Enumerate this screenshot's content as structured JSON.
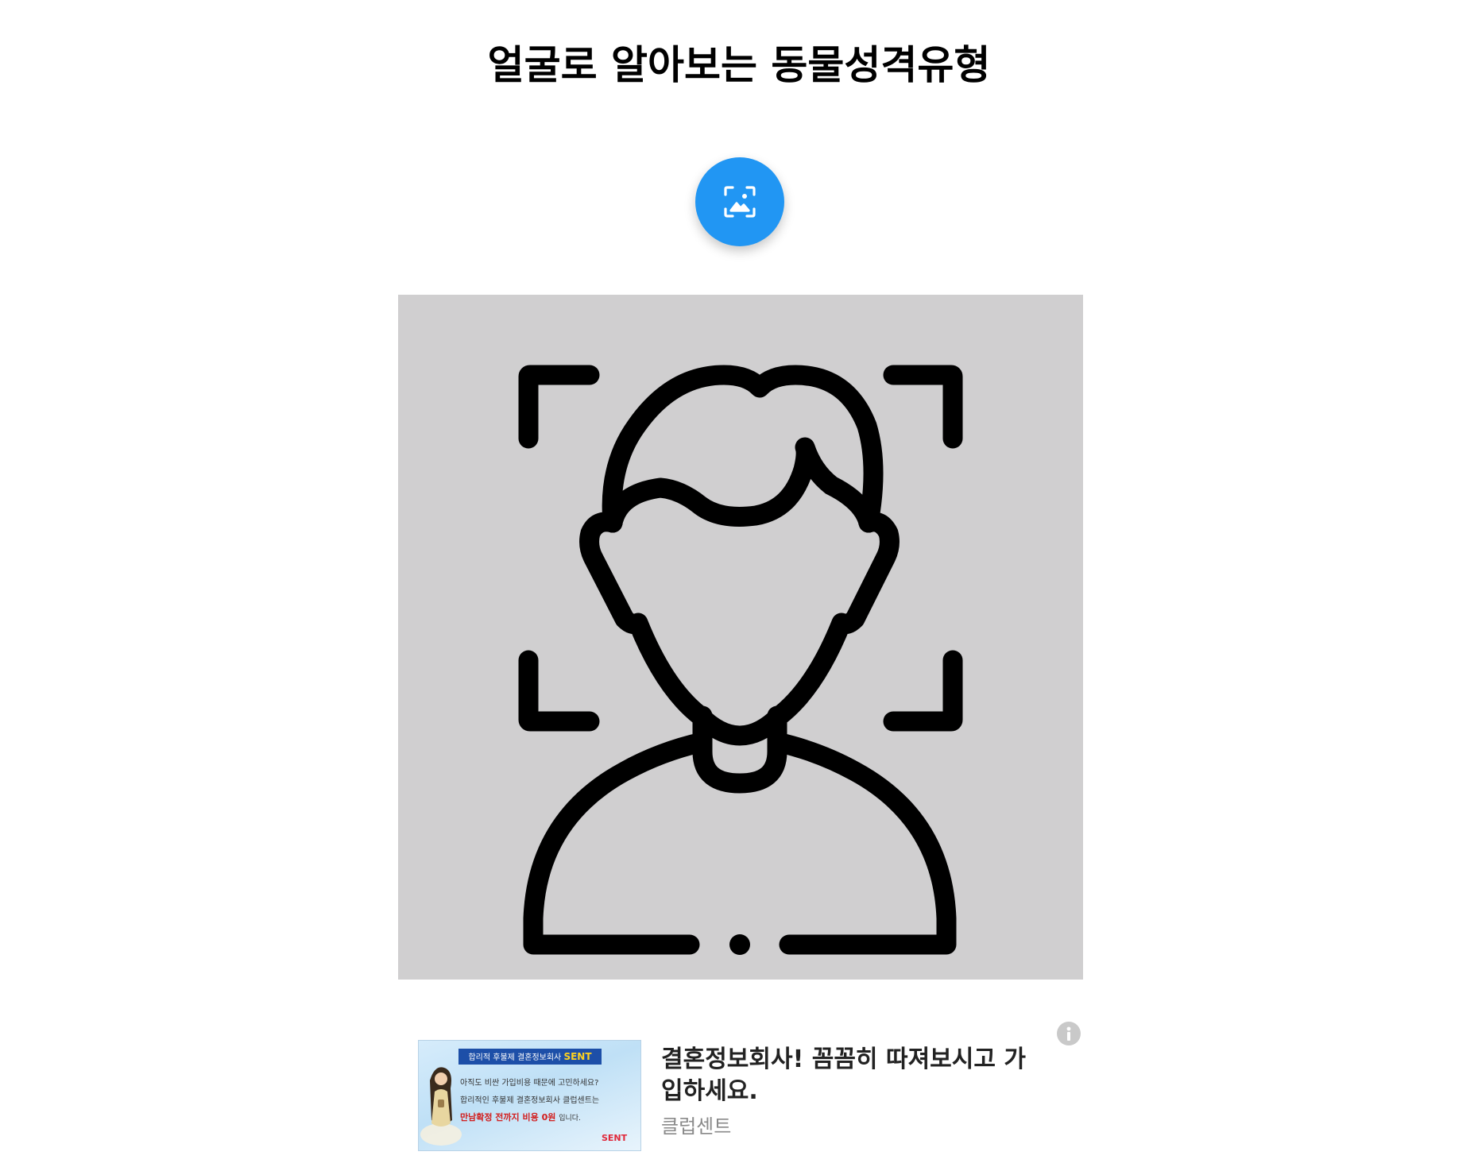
{
  "header": {
    "title": "얼굴로 알아보는 동물성격유형"
  },
  "upload": {
    "icon": "image-scan-icon",
    "button_color": "#2196f3"
  },
  "preview": {
    "icon": "face-scan-person-icon",
    "background": "#d0cfd0"
  },
  "ad": {
    "info_icon": "info-icon",
    "thumbnail": {
      "banner_prefix": "합리적 후불제 결혼정보회사",
      "banner_brand": "SENT",
      "line1": "아직도 비싼 가입비용 때문에 고민하세요?",
      "line2": "합리적인 후불제 결혼정보회사 클럽센트는",
      "line3": "만남확정 전까지 비용 0원",
      "line3_tail": "입니다.",
      "logo": "SENT"
    },
    "headline": "결혼정보회사! 꼼꼼히 따져보시고 가입하세요.",
    "advertiser": "클럽센트"
  }
}
